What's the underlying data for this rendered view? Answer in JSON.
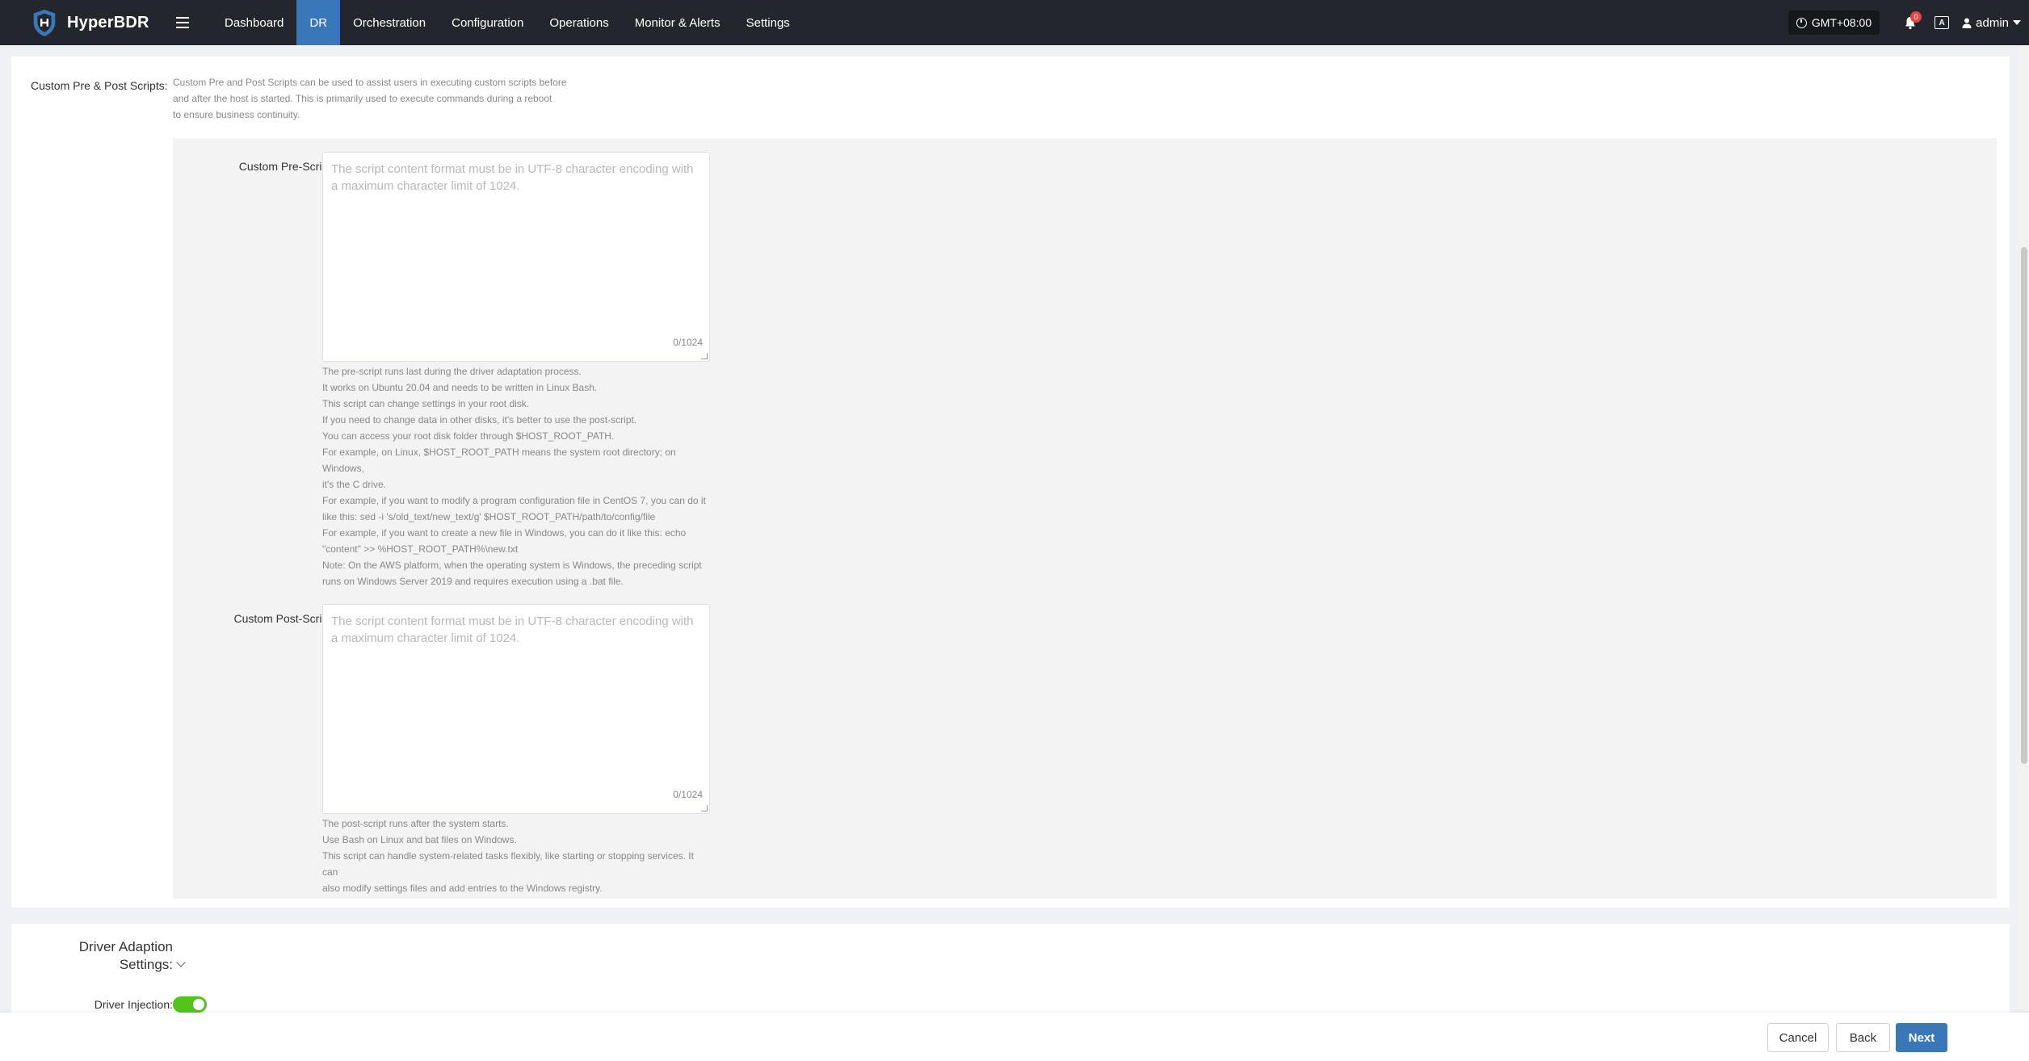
{
  "app": {
    "name": "HyperBDR"
  },
  "nav": {
    "items": [
      "Dashboard",
      "DR",
      "Orchestration",
      "Configuration",
      "Operations",
      "Monitor & Alerts",
      "Settings"
    ],
    "active_index": 1
  },
  "topbar": {
    "timezone": "GMT+08:00",
    "notification_count": "0",
    "language_icon": "A",
    "user": "admin"
  },
  "scripts": {
    "label": "Custom Pre & Post Scripts:",
    "description": [
      "Custom Pre and Post Scripts can be used to assist users in executing custom scripts before",
      "and after the host is started. This is primarily used to execute commands during a reboot",
      "to ensure business continuity."
    ],
    "pre": {
      "label": "Custom Pre-Script:",
      "placeholder": "The script content format must be in UTF-8 character encoding with a maximum character limit of 1024.",
      "value": "",
      "counter": "0/1024",
      "help": [
        "The pre-script runs last during the driver adaptation process.",
        "It works on Ubuntu 20.04 and needs to be written in Linux Bash.",
        "This script can change settings in your root disk.",
        "If you need to change data in other disks, it's better to use the post-script.",
        "You can access your root disk folder through $HOST_ROOT_PATH.",
        "For example, on Linux, $HOST_ROOT_PATH means the system root directory; on Windows,",
        "it's the C drive.",
        "For example, if you want to modify a program configuration file in CentOS 7, you can do it",
        "like this: sed -i 's/old_text/new_text/g' $HOST_ROOT_PATH/path/to/config/file",
        "For example, if you want to create a new file in Windows, you can do it like this: echo",
        "\"content\" >> %HOST_ROOT_PATH%\\new.txt",
        "Note: On the AWS platform, when the operating system is Windows, the preceding script",
        "runs on Windows Server 2019 and requires execution using a .bat file."
      ]
    },
    "post": {
      "label": "Custom Post-Script:",
      "placeholder": "The script content format must be in UTF-8 character encoding with a maximum character limit of 1024.",
      "value": "",
      "counter": "0/1024",
      "help": [
        "The post-script runs after the system starts.",
        "Use Bash on Linux and bat files on Windows.",
        "This script can handle system-related tasks flexibly, like starting or stopping services. It can",
        "also modify settings files and add entries to the Windows registry."
      ]
    }
  },
  "driver": {
    "title_line1": "Driver Adaption",
    "title_line2": "Settings:",
    "injection_label": "Driver Injection:",
    "injection_enabled": true
  },
  "footer": {
    "cancel": "Cancel",
    "back": "Back",
    "next": "Next"
  },
  "colors": {
    "topbar": "#23272d",
    "active_nav": "#3a77b8",
    "primary": "#3a77b8",
    "toggle_on": "#52c41a"
  }
}
